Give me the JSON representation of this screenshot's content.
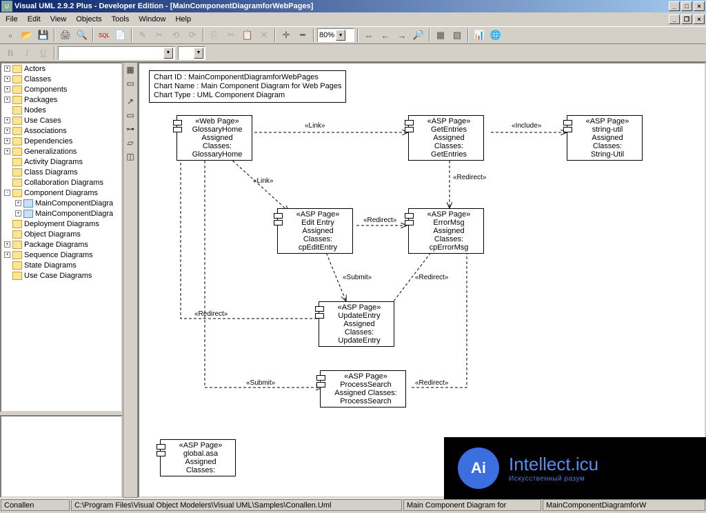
{
  "window": {
    "title": "Visual UML 2.9.2 Plus - Developer Edition - [MainComponentDiagramforWebPages]"
  },
  "menu": [
    "File",
    "Edit",
    "View",
    "Objects",
    "Tools",
    "Window",
    "Help"
  ],
  "zoom": "80%",
  "tree": [
    {
      "lvl": 0,
      "tgl": "+",
      "label": "Actors"
    },
    {
      "lvl": 0,
      "tgl": "+",
      "label": "Classes"
    },
    {
      "lvl": 0,
      "tgl": "+",
      "label": "Components"
    },
    {
      "lvl": 0,
      "tgl": "+",
      "label": "Packages"
    },
    {
      "lvl": 0,
      "tgl": "",
      "label": "Nodes"
    },
    {
      "lvl": 0,
      "tgl": "+",
      "label": "Use Cases"
    },
    {
      "lvl": 0,
      "tgl": "+",
      "label": "Associations"
    },
    {
      "lvl": 0,
      "tgl": "+",
      "label": "Dependencies"
    },
    {
      "lvl": 0,
      "tgl": "+",
      "label": "Generalizations"
    },
    {
      "lvl": 0,
      "tgl": "",
      "label": "Activity Diagrams"
    },
    {
      "lvl": 0,
      "tgl": "",
      "label": "Class Diagrams"
    },
    {
      "lvl": 0,
      "tgl": "",
      "label": "Collaboration Diagrams"
    },
    {
      "lvl": 0,
      "tgl": "-",
      "label": "Component Diagrams"
    },
    {
      "lvl": 1,
      "tgl": "+",
      "label": "MainComponentDiagra",
      "d": true
    },
    {
      "lvl": 1,
      "tgl": "+",
      "label": "MainComponentDiagra",
      "d": true
    },
    {
      "lvl": 0,
      "tgl": "",
      "label": "Deployment Diagrams"
    },
    {
      "lvl": 0,
      "tgl": "",
      "label": "Object Diagrams"
    },
    {
      "lvl": 0,
      "tgl": "+",
      "label": "Package Diagrams"
    },
    {
      "lvl": 0,
      "tgl": "+",
      "label": "Sequence Diagrams"
    },
    {
      "lvl": 0,
      "tgl": "",
      "label": "State Diagrams"
    },
    {
      "lvl": 0,
      "tgl": "",
      "label": "Use Case Diagrams"
    }
  ],
  "info": {
    "l1": "Chart ID : MainComponentDiagramforWebPages",
    "l2": "Chart Name : Main Component Diagram for Web Pages",
    "l3": "Chart Type : UML Component Diagram"
  },
  "comps": {
    "glossary": {
      "s": "«Web Page»",
      "n": "GlossaryHome",
      "a": "Assigned Classes:",
      "c": "GlossaryHome"
    },
    "getentries": {
      "s": "«ASP Page»",
      "n": "GetEntries",
      "a": "Assigned Classes:",
      "c": "GetEntries"
    },
    "stringutil": {
      "s": "«ASP Page»",
      "n": "string-util",
      "a": "Assigned Classes:",
      "c": "String-Util"
    },
    "editentry": {
      "s": "«ASP Page»",
      "n": "Edit Entry",
      "a": "Assigned Classes:",
      "c": "cpEditEntry"
    },
    "errormsg": {
      "s": "«ASP Page»",
      "n": "ErrorMsg",
      "a": "Assigned Classes:",
      "c": "cpErrorMsg"
    },
    "updateentry": {
      "s": "«ASP Page»",
      "n": "UpdateEntry",
      "a": "Assigned Classes:",
      "c": "UpdateEntry"
    },
    "processsearch": {
      "s": "«ASP Page»",
      "n": "ProcessSearch",
      "a": "Assigned Classes:",
      "c": "ProcessSearch"
    },
    "global": {
      "s": "«ASP Page»",
      "n": "global.asa",
      "a": "Assigned Classes:",
      "c": ""
    }
  },
  "labels": {
    "link1": "«Link»",
    "include": "«Include»",
    "link2": "«Link»",
    "redirect1": "«Redirect»",
    "redirect2": "«Redirect»",
    "redirect3": "«Redirect»",
    "redirect4": "«Redirect»",
    "redirect5": "«Redirect»",
    "submit1": "«Submit»",
    "submit2": "«Submit»"
  },
  "status": {
    "s1": "Conallen",
    "s2": "C:\\Program Files\\Visual Object Modelers\\Visual UML\\Samples\\Conallen.Uml",
    "s3": "Main Component Diagram for",
    "s4": "MainComponentDiagramforW"
  },
  "wm": {
    "brand": "Intellect.icu",
    "sub": "Искусственный разум",
    "ai": "Ai"
  }
}
